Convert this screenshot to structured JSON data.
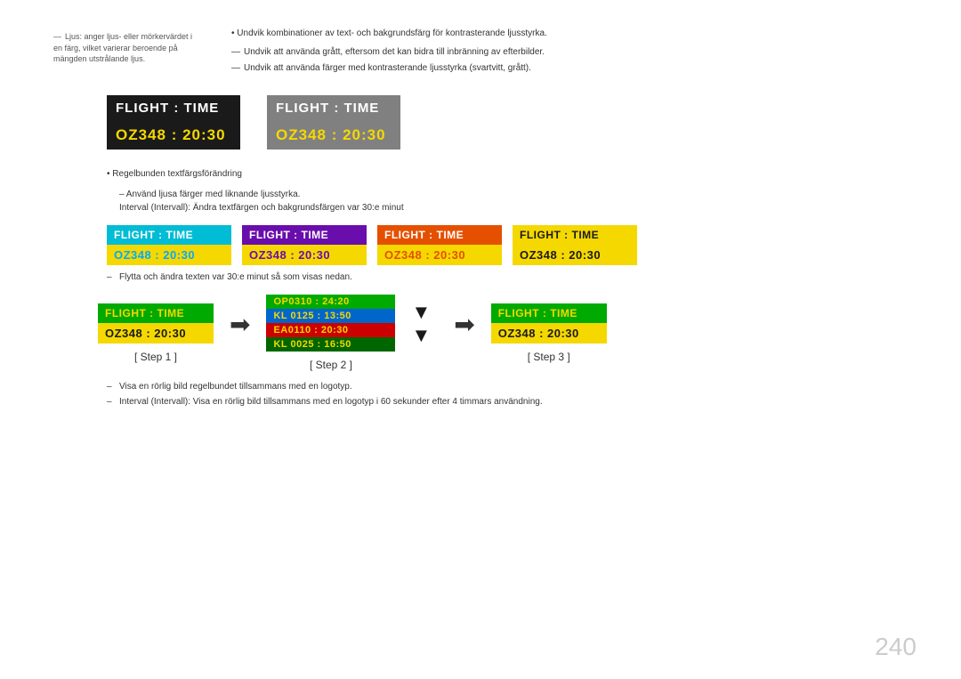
{
  "leftNote": {
    "text": "Ljus: anger ljus- eller mörkervärdet i en färg, vilket varierar beroende på mängden utstrålande ljus."
  },
  "topBullets": [
    "Undvik kombinationer av text- och bakgrundsfärg för kontrasterande ljusstyrka."
  ],
  "topDashes": [
    "Undvik att använda grått, eftersom det kan bidra till inbränning av efterbilder.",
    "Undvik att använda färger med kontrasterande ljusstyrka (svartvitt, grått)."
  ],
  "box1": {
    "header": "FLIGHT  :  TIME",
    "data": "OZ348   :  20:30"
  },
  "box2": {
    "header": "FLIGHT  :  TIME",
    "data": "OZ348   :  20:30"
  },
  "sectionBullet": "Regelbunden textfärgsförändring",
  "sectionSub1": "Använd ljusa färger med liknande ljusstyrka.",
  "sectionSub2": "Interval (Intervall): Ändra textfärgen och bakgrundsfärgen var 30:e minut",
  "coloredBoxes": [
    {
      "header": "FLIGHT  :  TIME",
      "data": "OZ348   :  20:30",
      "theme": "cyan"
    },
    {
      "header": "FLIGHT  :  TIME",
      "data": "OZ348   :  20:30",
      "theme": "purple"
    },
    {
      "header": "FLIGHT  :  TIME",
      "data": "OZ348   :  20:30",
      "theme": "orange"
    },
    {
      "header": "FLIGHT  :  TIME",
      "data": "OZ348   :  20:30",
      "theme": "yellow"
    }
  ],
  "dashNote": "Flytta och ändra texten var 30:e minut så som visas nedan.",
  "step1": {
    "header": "FLIGHT  :  TIME",
    "data": "OZ348   :  20:30",
    "label": "[ Step 1 ]"
  },
  "step2": {
    "rows": [
      "OP0310  :  24:20",
      "KL 0125  :  13:50",
      "EA0110  :  20:30",
      "KL 0025  :  16:50"
    ],
    "label": "[ Step 2 ]"
  },
  "step3": {
    "header": "FLIGHT  :  TIME",
    "data": "OZ348   :  20:30",
    "label": "[ Step 3 ]"
  },
  "finalDashes": [
    "Visa en rörlig bild regelbundet tillsammans med en logotyp.",
    "Interval (Intervall): Visa en rörlig bild tillsammans med en logotyp i 60 sekunder efter 4 timmars användning."
  ],
  "pageNumber": "240"
}
